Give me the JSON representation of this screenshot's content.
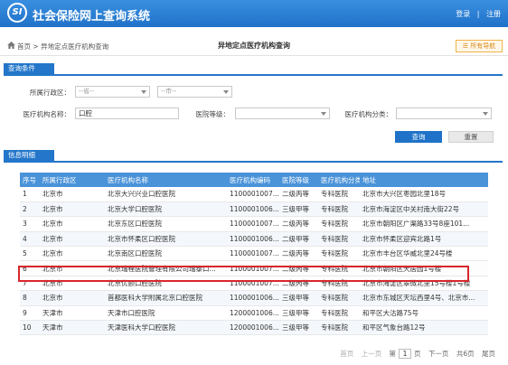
{
  "header": {
    "logo_text": "SI",
    "title": "社会保险网上查询系统",
    "links": [
      "登录",
      "注册"
    ],
    "separator": "|"
  },
  "breadcrumb": {
    "items": [
      "首页",
      "异地定点医疗机构查询"
    ],
    "separator": ">",
    "page_title": "异地定点医疗机构查询",
    "nav_button": "所有导航"
  },
  "conditions": {
    "section_title": "查询条件",
    "region_label": "所属行政区：",
    "province_select": "--省--",
    "city_select": "--市--",
    "name_label": "医疗机构名称：",
    "name_value": "口腔",
    "level_label": "医院等级：",
    "level_select": "",
    "category_label": "医疗机构分类：",
    "category_select": "",
    "search_button": "查询",
    "reset_button": "重置"
  },
  "results": {
    "section_title": "信息明细",
    "columns": [
      "序号",
      "所属行政区",
      "医疗机构名称",
      "医疗机构编码",
      "医院等级",
      "医疗机构分类",
      "地址"
    ],
    "rows": [
      [
        "1",
        "北京市",
        "北京大兴兴业口腔医院",
        "1100001007...",
        "二级丙等",
        "专科医院",
        "北京市大兴区枣园北里18号"
      ],
      [
        "2",
        "北京市",
        "北京大学口腔医院",
        "1100001006...",
        "三级甲等",
        "专科医院",
        "北京市海淀区中关村南大街22号"
      ],
      [
        "3",
        "北京市",
        "北京东区口腔医院",
        "1100001007...",
        "二级丙等",
        "专科医院",
        "北京市朝阳区广渠路33号8座101..."
      ],
      [
        "4",
        "北京市",
        "北京市怀柔区口腔医院",
        "1100001006...",
        "二级甲等",
        "专科医院",
        "北京市怀柔区迎宾北路1号"
      ],
      [
        "5",
        "北京市",
        "北京南区口腔医院",
        "1100001007...",
        "二级丙等",
        "专科医院",
        "北京市丰台区华威北里24号楼"
      ],
      [
        "6",
        "北京市",
        "北京瑞程医院管理有限公司瑞泰口...",
        "1100001007...",
        "二级丙等",
        "专科医院",
        "北京市朝阳区天居园1号楼"
      ],
      [
        "7",
        "北京市",
        "北京优颐口腔医院",
        "1100001007...",
        "二级丙等",
        "专科医院",
        "北京市海淀区翠微北里15号楼1号楼"
      ],
      [
        "8",
        "北京市",
        "首都医科大学附属北京口腔医院",
        "1100001006...",
        "三级甲等",
        "专科医院",
        "北京市东城区天坛西里4号、北京市..."
      ],
      [
        "9",
        "天津市",
        "天津市口腔医院",
        "1200001006...",
        "三级甲等",
        "专科医院",
        "和平区大沽路75号"
      ],
      [
        "10",
        "天津市",
        "天津医科大学口腔医院",
        "1200001006...",
        "三级甲等",
        "专科医院",
        "和平区气象台路12号"
      ]
    ],
    "highlighted_row": 6
  },
  "pager": {
    "first": "首页",
    "prev": "上一页",
    "page_prefix": "第",
    "page": "1",
    "page_suffix": "页",
    "next": "下一页",
    "total": "共6页",
    "last": "尾页"
  },
  "colors": {
    "header_blue": "#1f72c8",
    "table_header": "#4a93d9",
    "highlight_red": "#d9262c",
    "nav_orange": "#f0b24a"
  },
  "icons": [
    "home-icon",
    "menu-icon"
  ]
}
